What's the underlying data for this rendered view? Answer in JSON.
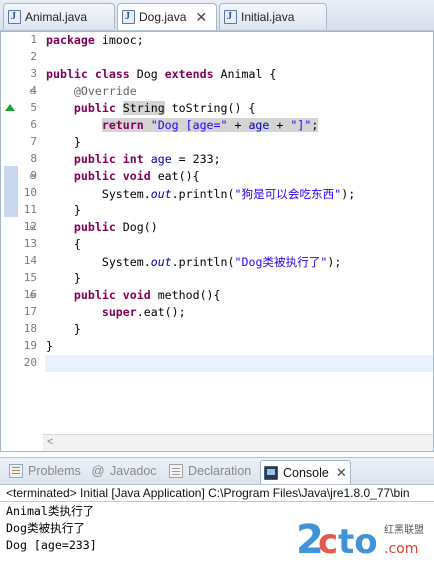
{
  "editor_tabs": [
    {
      "label": "Animal.java",
      "active": false
    },
    {
      "label": "Dog.java",
      "active": true
    },
    {
      "label": "Initial.java",
      "active": false
    }
  ],
  "editor": {
    "lines": [
      {
        "n": "1"
      },
      {
        "n": "2"
      },
      {
        "n": "3"
      },
      {
        "n": "4"
      },
      {
        "n": "5"
      },
      {
        "n": "6"
      },
      {
        "n": "7"
      },
      {
        "n": "8"
      },
      {
        "n": "9"
      },
      {
        "n": "10"
      },
      {
        "n": "11"
      },
      {
        "n": "12"
      },
      {
        "n": "13"
      },
      {
        "n": "14"
      },
      {
        "n": "15"
      },
      {
        "n": "16"
      },
      {
        "n": "17"
      },
      {
        "n": "18"
      },
      {
        "n": "19"
      },
      {
        "n": "20"
      }
    ],
    "t": {
      "package": "package",
      "pkg_name": " imooc;",
      "public": "public",
      "class": "class",
      "dog": "Dog",
      "extends": "extends",
      "animal_brace": " Animal {",
      "override": "@Override",
      "string_type": "String",
      "tostring_sig": " toString() {",
      "return": "return",
      "str_age": "\"Dog [age=\"",
      "plus_age_plus": " + ",
      "age": "age",
      "str_close": "\"]\"",
      "semi": ";",
      "close_brace": "}",
      "int": "int",
      "age_assign": " = 233;",
      "void": "void",
      "eat_sig": " eat(){",
      "sysout_pre": "System.",
      "out": "out",
      "println_open": ".println(",
      "str_dog_eat": "\"狗是可以会吃东西\"",
      "paren_semi": ");",
      "dog_ctor": " Dog()",
      "open_brace": "{",
      "str_dog_run": "\"Dog类被执行了\"",
      "method_sig": " method(){",
      "super": "super",
      "eat_call": ".eat();"
    }
  },
  "views_tabs": [
    {
      "label": "Problems",
      "icon": "problems-icon",
      "active": false
    },
    {
      "label": "Javadoc",
      "icon": "javadoc-icon",
      "active": false
    },
    {
      "label": "Declaration",
      "icon": "declaration-icon",
      "active": false
    },
    {
      "label": "Console",
      "icon": "console-icon",
      "active": true
    }
  ],
  "console": {
    "header": "<terminated> Initial [Java Application] C:\\Program Files\\Java\\jre1.8.0_77\\bin",
    "output": [
      "Animal类执行了",
      "Dog类被执行了",
      "Dog [age=233]"
    ]
  },
  "colors": {
    "keyword": "#7f0055",
    "string": "#2a00ff",
    "field": "#0000c0",
    "annotation": "#646464",
    "current_line": "#e8f2fe",
    "watermark_blue": "#1f7fd3",
    "watermark_red": "#e23c2e"
  },
  "watermark": {
    "logo": "2cto",
    "sub": "红黑联盟",
    "domain": ".com"
  }
}
